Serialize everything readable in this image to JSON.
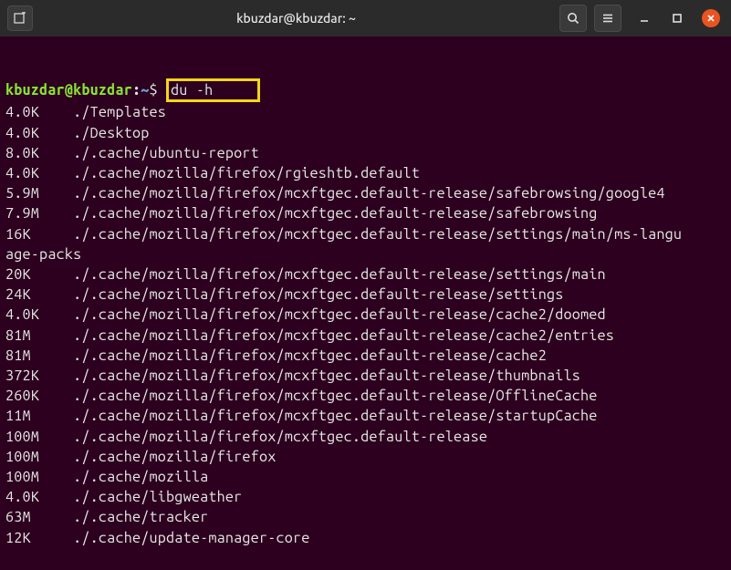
{
  "titlebar": {
    "title": "kbuzdar@kbuzdar: ~"
  },
  "prompt": {
    "user_host": "kbuzdar@kbuzdar",
    "separator": ":",
    "path": "~",
    "symbol": "$"
  },
  "command": "du -h",
  "output": [
    {
      "size": "4.0K",
      "path": "./Templates"
    },
    {
      "size": "4.0K",
      "path": "./Desktop"
    },
    {
      "size": "8.0K",
      "path": "./.cache/ubuntu-report"
    },
    {
      "size": "4.0K",
      "path": "./.cache/mozilla/firefox/rgieshtb.default"
    },
    {
      "size": "5.9M",
      "path": "./.cache/mozilla/firefox/mcxftgec.default-release/safebrowsing/google4"
    },
    {
      "size": "7.9M",
      "path": "./.cache/mozilla/firefox/mcxftgec.default-release/safebrowsing"
    },
    {
      "size": "16K",
      "path": "./.cache/mozilla/firefox/mcxftgec.default-release/settings/main/ms-language-packs",
      "wrap": true
    },
    {
      "size": "20K",
      "path": "./.cache/mozilla/firefox/mcxftgec.default-release/settings/main"
    },
    {
      "size": "24K",
      "path": "./.cache/mozilla/firefox/mcxftgec.default-release/settings"
    },
    {
      "size": "4.0K",
      "path": "./.cache/mozilla/firefox/mcxftgec.default-release/cache2/doomed"
    },
    {
      "size": "81M",
      "path": "./.cache/mozilla/firefox/mcxftgec.default-release/cache2/entries"
    },
    {
      "size": "81M",
      "path": "./.cache/mozilla/firefox/mcxftgec.default-release/cache2"
    },
    {
      "size": "372K",
      "path": "./.cache/mozilla/firefox/mcxftgec.default-release/thumbnails"
    },
    {
      "size": "260K",
      "path": "./.cache/mozilla/firefox/mcxftgec.default-release/OfflineCache"
    },
    {
      "size": "11M",
      "path": "./.cache/mozilla/firefox/mcxftgec.default-release/startupCache"
    },
    {
      "size": "100M",
      "path": "./.cache/mozilla/firefox/mcxftgec.default-release"
    },
    {
      "size": "100M",
      "path": "./.cache/mozilla/firefox"
    },
    {
      "size": "100M",
      "path": "./.cache/mozilla"
    },
    {
      "size": "4.0K",
      "path": "./.cache/libgweather"
    },
    {
      "size": "63M",
      "path": "./.cache/tracker"
    },
    {
      "size": "12K",
      "path": "./.cache/update-manager-core"
    }
  ]
}
